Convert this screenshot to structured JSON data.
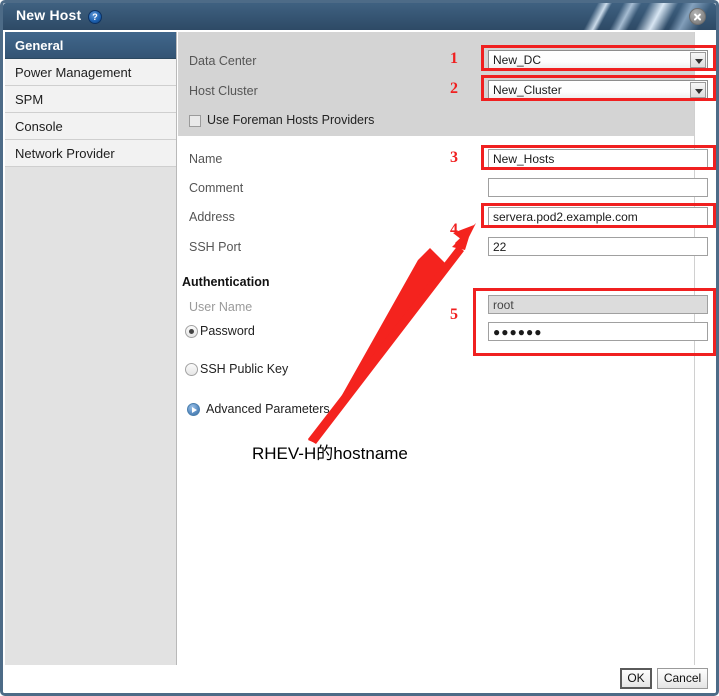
{
  "window": {
    "title": "New Host",
    "help_icon": "question-mark-icon",
    "close_icon": "close-icon"
  },
  "sidebar": {
    "items": [
      {
        "label": "General",
        "active": true
      },
      {
        "label": "Power Management",
        "active": false
      },
      {
        "label": "SPM",
        "active": false
      },
      {
        "label": "Console",
        "active": false
      },
      {
        "label": "Network Provider",
        "active": false
      }
    ]
  },
  "form": {
    "data_center": {
      "label": "Data Center",
      "value": "New_DC"
    },
    "host_cluster": {
      "label": "Host Cluster",
      "value": "New_Cluster"
    },
    "foreman": {
      "label": "Use Foreman Hosts Providers",
      "checked": false
    },
    "name": {
      "label": "Name",
      "value": "New_Hosts"
    },
    "comment": {
      "label": "Comment",
      "value": ""
    },
    "address": {
      "label": "Address",
      "value": "servera.pod2.example.com"
    },
    "ssh_port": {
      "label": "SSH Port",
      "value": "22"
    },
    "authentication": {
      "heading": "Authentication",
      "user_name_label": "User Name",
      "user_name_value": "root",
      "password_label": "Password",
      "password_value": "●●●●●●",
      "password_selected": true,
      "ssh_public_key_label": "SSH Public Key",
      "ssh_public_key_selected": false
    },
    "advanced_parameters": {
      "label": "Advanced Parameters"
    }
  },
  "annotations": {
    "markers": [
      "1",
      "2",
      "3",
      "4",
      "5"
    ],
    "note": "RHEV-H的hostname",
    "highlight_color": "#f02020"
  },
  "footer": {
    "ok_label": "OK",
    "cancel_label": "Cancel"
  }
}
